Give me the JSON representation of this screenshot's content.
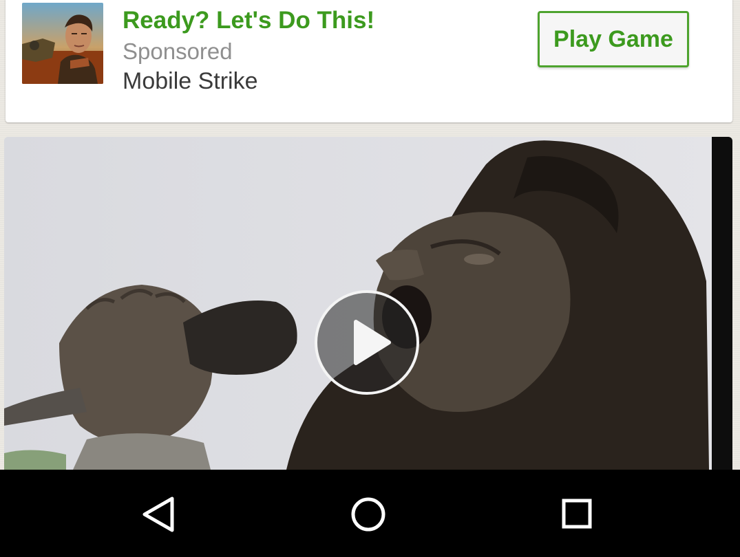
{
  "ad": {
    "headline": "Ready? Let's Do This!",
    "sponsored_label": "Sponsored",
    "advertiser": "Mobile Strike",
    "cta_label": "Play Game",
    "thumbnail_icon": "game-thumbnail-image",
    "accent_color": "#3c9a1e"
  },
  "video": {
    "play_icon": "play-icon"
  },
  "navbar": {
    "back_icon": "back-triangle-icon",
    "home_icon": "home-circle-icon",
    "recents_icon": "recents-square-icon"
  }
}
